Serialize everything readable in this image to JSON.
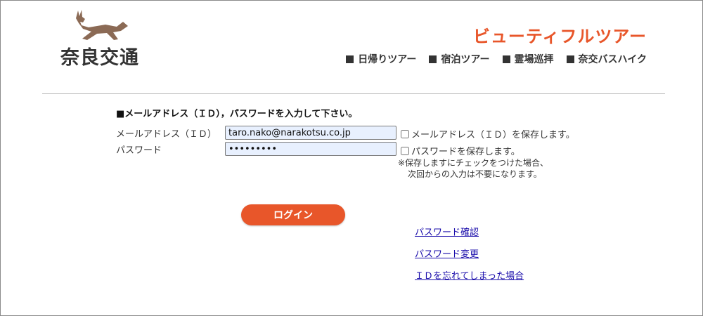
{
  "header": {
    "logo_text": "奈良交通",
    "brand_title": "ビューティフルツアー",
    "nav": [
      {
        "label": "日帰りツアー"
      },
      {
        "label": "宿泊ツアー"
      },
      {
        "label": "霊場巡拝"
      },
      {
        "label": "奈交バスハイク"
      }
    ]
  },
  "colors": {
    "accent": "#e8562a",
    "logo_deer": "#8b6a55",
    "link": "#1a0dab"
  },
  "form": {
    "instruction": "■メールアドレス（ＩＤ），パスワードを入力して下さい。",
    "email_label": "メールアドレス（ＩＤ）",
    "email_value": "taro.nako@narakotsu.co.jp",
    "password_label": "パスワード",
    "password_value": "•••••••••",
    "save_email_label": "メールアドレス（ＩＤ）を保存します。",
    "save_password_label": "パスワードを保存します。",
    "note_line1": "※保存しますにチェックをつけた場合、",
    "note_line2": "次回からの入力は不要になります。",
    "login_label": "ログイン"
  },
  "links": [
    {
      "label": "パスワード確認"
    },
    {
      "label": "パスワード変更"
    },
    {
      "label": "ＩＤを忘れてしまった場合"
    }
  ]
}
